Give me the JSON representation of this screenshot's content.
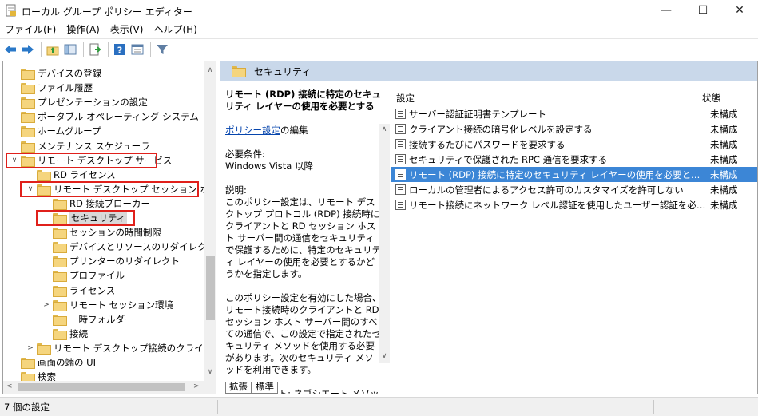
{
  "window": {
    "title": "ローカル グループ ポリシー エディター",
    "min_glyph": "—",
    "max_glyph": "☐",
    "close_glyph": "✕"
  },
  "menu": [
    "ファイル(F)",
    "操作(A)",
    "表示(V)",
    "ヘルプ(H)"
  ],
  "toolbar": {
    "icons": [
      "back-icon",
      "forward-icon",
      "up-folder-icon",
      "show-hide-tree-icon",
      "export-list-icon",
      "help-icon",
      "properties-icon",
      "filter-icon"
    ]
  },
  "tree": {
    "items": [
      {
        "label": "デバイスの登録",
        "indent": 0,
        "expander": ""
      },
      {
        "label": "ファイル履歴",
        "indent": 0,
        "expander": ""
      },
      {
        "label": "プレゼンテーションの設定",
        "indent": 0,
        "expander": ""
      },
      {
        "label": "ポータブル オペレーティング システム",
        "indent": 0,
        "expander": ""
      },
      {
        "label": "ホームグループ",
        "indent": 0,
        "expander": ""
      },
      {
        "label": "メンテナンス スケジューラ",
        "indent": 0,
        "expander": ""
      },
      {
        "label": "リモート デスクトップ サービス",
        "indent": 0,
        "expander": "∨"
      },
      {
        "label": "RD ライセンス",
        "indent": 1,
        "expander": ""
      },
      {
        "label": "リモート デスクトップ セッション ホスト",
        "indent": 1,
        "expander": "∨"
      },
      {
        "label": "RD 接続ブローカー",
        "indent": 2,
        "expander": ""
      },
      {
        "label": "セキュリティ",
        "indent": 2,
        "expander": ""
      },
      {
        "label": "セッションの時間制限",
        "indent": 2,
        "expander": ""
      },
      {
        "label": "デバイスとリソースのリダイレクト",
        "indent": 2,
        "expander": ""
      },
      {
        "label": "プリンターのリダイレクト",
        "indent": 2,
        "expander": ""
      },
      {
        "label": "プロファイル",
        "indent": 2,
        "expander": ""
      },
      {
        "label": "ライセンス",
        "indent": 2,
        "expander": ""
      },
      {
        "label": "リモート セッション環境",
        "indent": 2,
        "expander": ">"
      },
      {
        "label": "一時フォルダー",
        "indent": 2,
        "expander": ""
      },
      {
        "label": "接続",
        "indent": 2,
        "expander": ""
      },
      {
        "label": "リモート デスクトップ接続のクライアント",
        "indent": 1,
        "expander": ">"
      },
      {
        "label": "画面の端の UI",
        "indent": 0,
        "expander": ""
      },
      {
        "label": "検索",
        "indent": 0,
        "expander": ""
      }
    ]
  },
  "right": {
    "header": "セキュリティ",
    "description": {
      "policy_title": "リモート (RDP) 接続に特定のセキュリティ レイヤーの使用を必要とする",
      "edit_link": "ポリシー設定",
      "edit_suffix": "の編集",
      "requirements_label": "必要条件:",
      "requirements_value": "Windows Vista 以降",
      "explanation_label": "説明:",
      "explanation_1": "このポリシー設定は、リモート デスクトップ プロトコル (RDP) 接続時にクライアントと RD セッション ホスト サーバー間の通信をセキュリティで保護するために、特定のセキュリティ レイヤーの使用を必要とするかどうかを指定します。",
      "explanation_2": "このポリシー設定を有効にした場合、リモート接続時のクライアントと RD セッション ホスト サーバー間のすべての通信で、この設定で指定されたセキュリティ メソッドを使用する必要があります。次のセキュリティ メソッドを利用できます。",
      "explanation_3": "* ネゴシエート: ネゴシエート メソッドで"
    },
    "columns": {
      "setting": "設定",
      "state": "状態"
    },
    "settings": [
      {
        "name": "サーバー認証証明書テンプレート",
        "state": "未構成"
      },
      {
        "name": "クライアント接続の暗号化レベルを設定する",
        "state": "未構成"
      },
      {
        "name": "接続するたびにパスワードを要求する",
        "state": "未構成"
      },
      {
        "name": "セキュリティで保護された RPC 通信を要求する",
        "state": "未構成"
      },
      {
        "name": "リモート (RDP) 接続に特定のセキュリティ レイヤーの使用を必要とする",
        "state": "未構成"
      },
      {
        "name": "ローカルの管理者によるアクセス許可のカスタマイズを許可しない",
        "state": "未構成"
      },
      {
        "name": "リモート接続にネットワーク レベル認証を使用したユーザー認証を必要...",
        "state": "未構成"
      }
    ],
    "tabs": [
      "拡張",
      "標準"
    ]
  },
  "status": {
    "text": "7 個の設定"
  },
  "colors": {
    "selection": "#3c86d6",
    "header_band": "#c9d8ea",
    "annotation": "#e0201b"
  }
}
